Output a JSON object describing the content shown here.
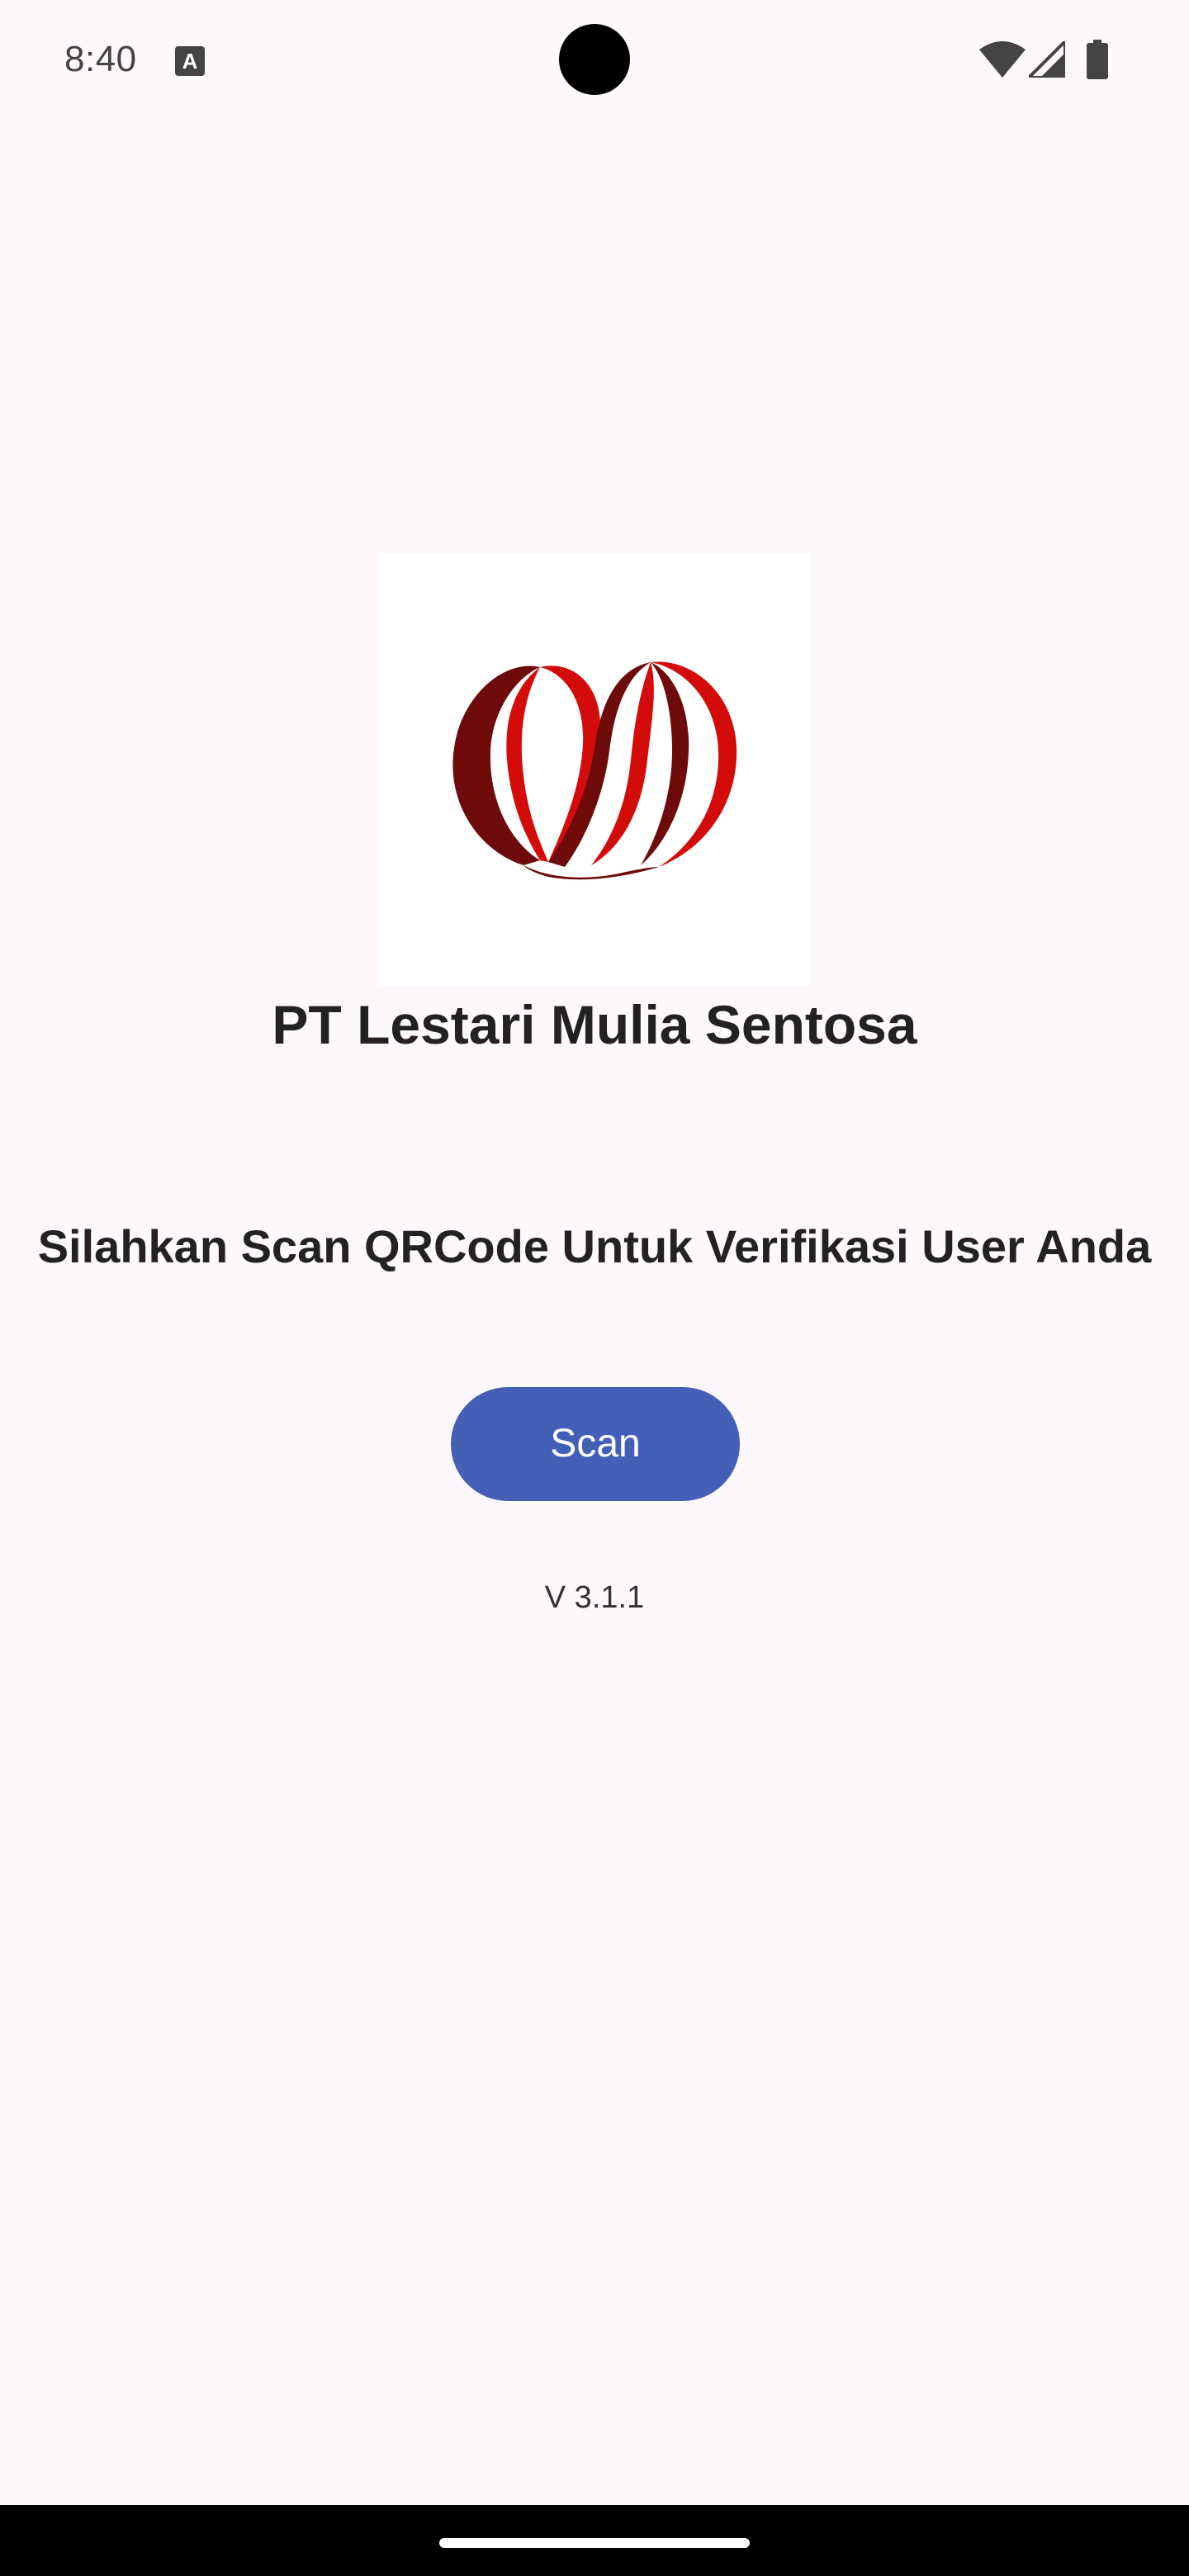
{
  "status_bar": {
    "time": "8:40",
    "notification_icon": "a-icon",
    "notification_glyph": "A",
    "icons": [
      "wifi-icon",
      "signal-icon",
      "battery-icon"
    ]
  },
  "main": {
    "logo_icon": "company-logo-ribbon-heart",
    "company_name": "PT Lestari Mulia Sentosa",
    "instruction": "Silahkan Scan QRCode Untuk Verifikasi User Anda",
    "scan_button_label": "Scan",
    "version": "V 3.1.1"
  },
  "colors": {
    "background": "#fdf8fb",
    "button": "#4360b6",
    "logo_red": "#d40b0b",
    "logo_dark_red": "#6e0a0a"
  }
}
